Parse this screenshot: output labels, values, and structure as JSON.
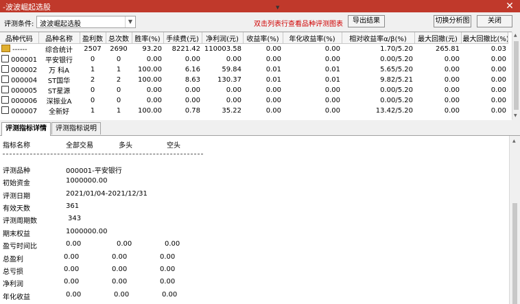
{
  "window": {
    "title": "-波波崛起选股",
    "close_glyph": "✕"
  },
  "toolbar": {
    "condition_label": "评测条件:",
    "condition_value": "波波崛起选股",
    "hint": "双击列表行查看品种评测图表",
    "export_label": "导出结果",
    "switch_label": "切换分析图",
    "close_label": "关闭"
  },
  "table": {
    "columns": [
      "品种代码",
      "品种名称",
      "盈利数",
      "总次数",
      "胜率(%)",
      "手续费(元)",
      "净利润(元)",
      "收益率(%)",
      "年化收益率(%)",
      "相对收益率α/β(%)",
      "最大回撤(元)",
      "最大回撤比(%)"
    ],
    "rows": [
      {
        "icon": "folder",
        "code": "------",
        "name": "综合统计",
        "win": "2507",
        "total": "2690",
        "rate": "93.20",
        "fee": "8221.42",
        "profit": "110003.58",
        "ret": "0.00",
        "annual": "0.00",
        "rel": "1.70/5.20",
        "dd": "265.81",
        "ddr": "0.03"
      },
      {
        "icon": "doc",
        "code": "000001",
        "name": "平安银行",
        "win": "0",
        "total": "0",
        "rate": "0.00",
        "fee": "0.00",
        "profit": "0.00",
        "ret": "0.00",
        "annual": "0.00",
        "rel": "0.00/5.20",
        "dd": "0.00",
        "ddr": "0.00"
      },
      {
        "icon": "doc",
        "code": "000002",
        "name": "万 科A",
        "win": "1",
        "total": "1",
        "rate": "100.00",
        "fee": "6.16",
        "profit": "59.84",
        "ret": "0.01",
        "annual": "0.01",
        "rel": "5.65/5.20",
        "dd": "0.00",
        "ddr": "0.00"
      },
      {
        "icon": "doc",
        "code": "000004",
        "name": "ST国华",
        "win": "2",
        "total": "2",
        "rate": "100.00",
        "fee": "8.63",
        "profit": "130.37",
        "ret": "0.01",
        "annual": "0.01",
        "rel": "9.82/5.21",
        "dd": "0.00",
        "ddr": "0.00"
      },
      {
        "icon": "doc",
        "code": "000005",
        "name": "ST星源",
        "win": "0",
        "total": "0",
        "rate": "0.00",
        "fee": "0.00",
        "profit": "0.00",
        "ret": "0.00",
        "annual": "0.00",
        "rel": "0.00/5.20",
        "dd": "0.00",
        "ddr": "0.00"
      },
      {
        "icon": "doc",
        "code": "000006",
        "name": "深振业A",
        "win": "0",
        "total": "0",
        "rate": "0.00",
        "fee": "0.00",
        "profit": "0.00",
        "ret": "0.00",
        "annual": "0.00",
        "rel": "0.00/5.20",
        "dd": "0.00",
        "ddr": "0.00"
      },
      {
        "icon": "doc",
        "code": "000007",
        "name": "全新好",
        "win": "1",
        "total": "1",
        "rate": "100.00",
        "fee": "0.78",
        "profit": "35.22",
        "ret": "0.00",
        "annual": "0.00",
        "rel": "13.42/5.20",
        "dd": "0.00",
        "ddr": "0.00"
      }
    ]
  },
  "tabs": [
    "评测指标详情",
    "评测指标说明"
  ],
  "detail": {
    "header": {
      "name": "指标名称",
      "all": "全部交易",
      "long": "多头",
      "short": "空头"
    },
    "info": [
      {
        "label": "评测品种",
        "value": "000001-平安银行"
      },
      {
        "label": "初始资金",
        "value": "1000000.00"
      },
      {
        "label": "评测日期",
        "value": "2021/01/04-2021/12/31"
      },
      {
        "label": "有效天数",
        "value": "361"
      },
      {
        "label": "评测周期数",
        "value": "343"
      },
      {
        "label": "期末权益",
        "value": "1000000.00"
      }
    ],
    "metrics": [
      {
        "label": "盈亏时间比",
        "all": "0.00",
        "long": "0.00",
        "short": "0.00"
      },
      {
        "label": "总盈利",
        "all": "0.00",
        "long": "0.00",
        "short": "0.00"
      },
      {
        "label": "总亏损",
        "all": "0.00",
        "long": "0.00",
        "short": "0.00"
      },
      {
        "label": "净利润",
        "all": "0.00",
        "long": "0.00",
        "short": "0.00"
      },
      {
        "label": "年化收益",
        "all": "0.00",
        "long": "0.00",
        "short": "0.00"
      }
    ]
  },
  "colors": {
    "titlebar": "#c0392b",
    "hint": "#d00000"
  }
}
